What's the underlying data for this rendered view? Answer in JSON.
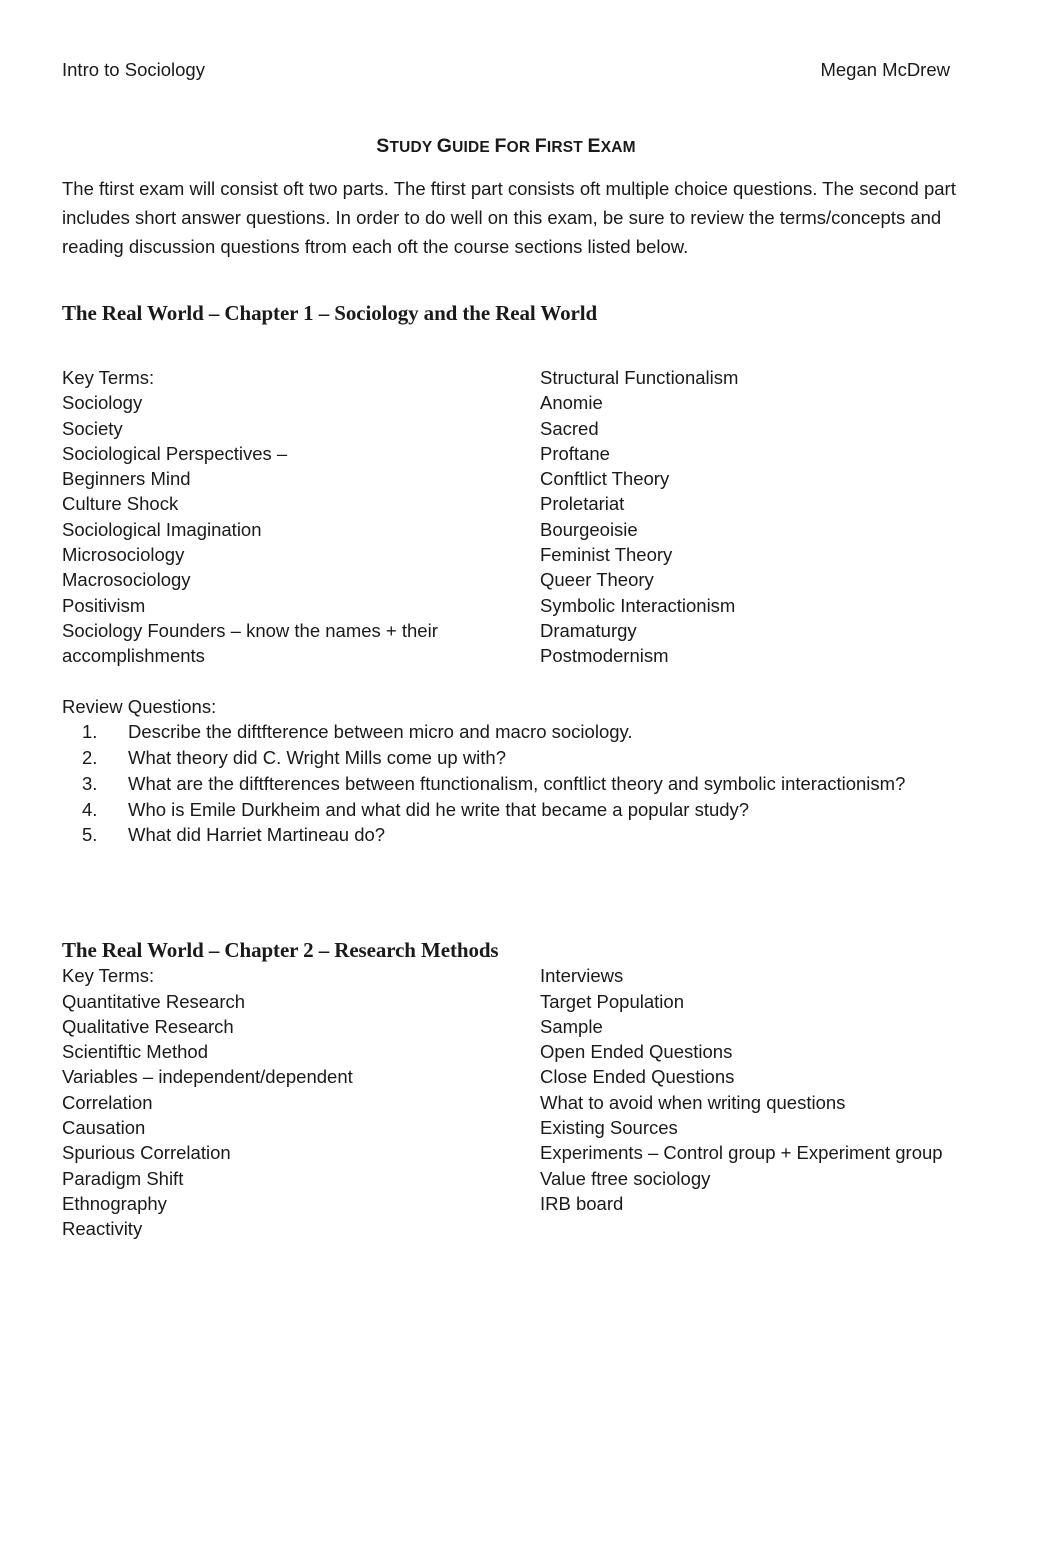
{
  "header": {
    "course": "Intro to Sociology",
    "author": "Megan McDrew"
  },
  "title": {
    "full": "STUDY GUIDE FOR FIRST EXAM",
    "parts": [
      {
        "cap": "S",
        "rest": "TUDY"
      },
      {
        "cap": "G",
        "rest": "UIDE"
      },
      {
        "cap": "F",
        "rest": "OR",
        "small_word": true
      },
      {
        "cap": "F",
        "rest": "IRST"
      },
      {
        "cap": "E",
        "rest": "XAM"
      }
    ]
  },
  "intro_paragraph": "The ftirst exam will consist oft two parts. The ftirst part consists oft multiple choice questions. The second part includes short answer questions. In order to do well on this exam, be sure to review the terms/concepts and reading discussion questions ftrom each oft the course sections listed below.",
  "sections": [
    {
      "heading": "The Real World – Chapter 1 – Sociology and the Real World",
      "key_terms_label": "Key Terms:",
      "terms_left": [
        "Key Terms:",
        "Sociology",
        "Society",
        "Sociological Perspectives –",
        "Beginners Mind",
        "Culture Shock",
        "Sociological Imagination",
        "Microsociology",
        "Macrosociology",
        "Positivism",
        "Sociology Founders – know the names + their",
        "accomplishments"
      ],
      "terms_right": [
        "Structural Functionalism",
        "Anomie",
        "Sacred",
        "Proftane",
        "Conftlict Theory",
        "Proletariat",
        "Bourgeoisie",
        "Feminist Theory",
        "Queer Theory",
        "Symbolic Interactionism",
        "Dramaturgy",
        "Postmodernism"
      ],
      "review_label": "Review Questions:",
      "review_questions": [
        {
          "num": "1.",
          "text": "Describe the diftfterence between micro and macro sociology."
        },
        {
          "num": "2.",
          "text": "What theory did C. Wright Mills come up with?"
        },
        {
          "num": "3.",
          "text": "What are the diftfterences between ftunctionalism, conftlict theory and symbolic interactionism?"
        },
        {
          "num": "4.",
          "text": "Who is Emile Durkheim and what did he write that became a popular study?"
        },
        {
          "num": "5.",
          "text": "What did Harriet Martineau do?"
        }
      ]
    },
    {
      "heading": "The Real World – Chapter 2 – Research Methods",
      "key_terms_label": "Key Terms:",
      "terms_left": [
        "Key Terms:",
        "Quantitative Research",
        "Qualitative Research",
        "Scientiftic Method",
        "Variables – independent/dependent",
        "Correlation",
        "Causation",
        "Spurious Correlation",
        "Paradigm Shift",
        "Ethnography",
        "Reactivity"
      ],
      "terms_right": [
        "Interviews",
        "Target Population",
        "Sample",
        "Open Ended Questions",
        "Close Ended Questions",
        "What to avoid when writing questions",
        "Existing Sources",
        "Experiments – Control group + Experiment group",
        "Value ftree sociology",
        "IRB board"
      ]
    }
  ],
  "colors": {
    "page_background": "#ffffff",
    "text": "#1a1a1a"
  }
}
